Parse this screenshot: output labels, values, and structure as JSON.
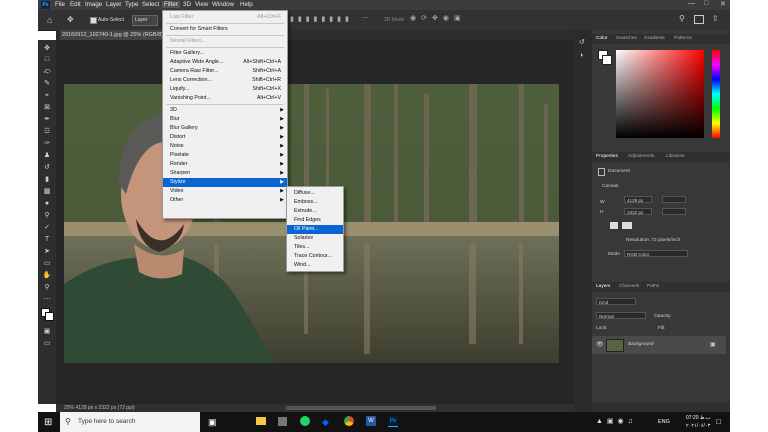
{
  "menubar": {
    "logo": "Ps",
    "items": [
      "File",
      "Edit",
      "Image",
      "Layer",
      "Type",
      "Select",
      "Filter",
      "3D",
      "View",
      "Window",
      "Help"
    ]
  },
  "options": {
    "auto_select_label": "Auto-Select",
    "auto_select_value": "Layer",
    "mode_label": "3D Mode"
  },
  "document": {
    "tab_title": "20160912_102740-1.jpg @ 25% (RGB/8)",
    "status": "25%     4128 px x 2322 px (72 ppi)"
  },
  "filter_menu": {
    "items": [
      {
        "label": "Last Filter",
        "shortcut": "Alt+Ctrl+F",
        "disabled": true
      },
      {
        "sep": true
      },
      {
        "label": "Convert for Smart Filters"
      },
      {
        "sep": true
      },
      {
        "label": "Neural Filters...",
        "disabled": true
      },
      {
        "sep": true
      },
      {
        "label": "Filter Gallery..."
      },
      {
        "label": "Adaptive Wide Angle...",
        "shortcut": "Alt+Shift+Ctrl+A"
      },
      {
        "label": "Camera Raw Filter...",
        "shortcut": "Shift+Ctrl+A"
      },
      {
        "label": "Lens Correction...",
        "shortcut": "Shift+Ctrl+R"
      },
      {
        "label": "Liquify...",
        "shortcut": "Shift+Ctrl+X"
      },
      {
        "label": "Vanishing Point...",
        "shortcut": "Alt+Ctrl+V"
      },
      {
        "sep": true
      },
      {
        "label": "3D",
        "submenu": true
      },
      {
        "label": "Blur",
        "submenu": true
      },
      {
        "label": "Blur Gallery",
        "submenu": true
      },
      {
        "label": "Distort",
        "submenu": true
      },
      {
        "label": "Noise",
        "submenu": true
      },
      {
        "label": "Pixelate",
        "submenu": true
      },
      {
        "label": "Render",
        "submenu": true
      },
      {
        "label": "Sharpen",
        "submenu": true
      },
      {
        "label": "Stylize",
        "submenu": true,
        "highlight": true
      },
      {
        "label": "Video",
        "submenu": true
      },
      {
        "label": "Other",
        "submenu": true
      }
    ]
  },
  "stylize_menu": {
    "items": [
      {
        "label": "Diffuse..."
      },
      {
        "label": "Emboss..."
      },
      {
        "label": "Extrude..."
      },
      {
        "label": "Find Edges"
      },
      {
        "label": "Oil Paint...",
        "highlight": true
      },
      {
        "label": "Solarize"
      },
      {
        "label": "Tiles..."
      },
      {
        "label": "Trace Contour..."
      },
      {
        "label": "Wind..."
      }
    ]
  },
  "panels": {
    "color_tabs": [
      "Color",
      "Swatches",
      "Gradients",
      "Patterns"
    ],
    "props_tabs": [
      "Properties",
      "Adjustments",
      "Libraries"
    ],
    "document_label": "Document",
    "canvas_label": "Canvas",
    "w_label": "W",
    "h_label": "H",
    "width_value": "4128 px",
    "height_value": "2322 px",
    "resolution": "Resolution: 72 pixels/inch",
    "mode_label": "Mode",
    "mode_value": "RGB Color",
    "layers_tabs": [
      "Layers",
      "Channels",
      "Paths"
    ],
    "kind_placeholder": "Kind",
    "blend_mode": "Normal",
    "opacity_label": "Opacity:",
    "lock_label": "Lock:",
    "fill_label": "Fill:",
    "layer_name": "Background"
  },
  "taskbar": {
    "search_placeholder": "Type here to search",
    "language": "ENG",
    "time": "07:20 ب.ظ",
    "date": "۲۰۲۱/۰۶/۰۳"
  },
  "colors": {
    "highlight": "#0a64d2",
    "panel": "#383838",
    "menubar": "#3c3c3c"
  }
}
